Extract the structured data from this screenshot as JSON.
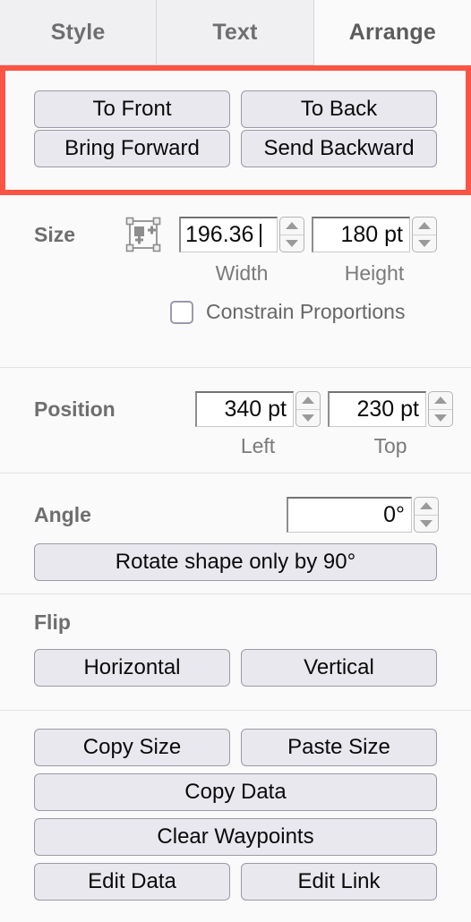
{
  "tabs": [
    {
      "id": "style",
      "label": "Style",
      "active": false
    },
    {
      "id": "text",
      "label": "Text",
      "active": false
    },
    {
      "id": "arrange",
      "label": "Arrange",
      "active": true
    }
  ],
  "order_section": {
    "highlighted": true,
    "highlight_color": "#fb5344",
    "buttons": {
      "to_front": "To Front",
      "to_back": "To Back",
      "bring_forward": "Bring Forward",
      "send_backward": "Send Backward"
    }
  },
  "size_section": {
    "title": "Size",
    "autosize_icon": "autosize-icon",
    "width": {
      "value": "196.36 ",
      "label": "Width",
      "focused": true
    },
    "height": {
      "value": "180 pt",
      "label": "Height",
      "focused": false
    },
    "constrain": {
      "label": "Constrain Proportions",
      "checked": false
    }
  },
  "position_section": {
    "title": "Position",
    "left": {
      "value": "340 pt",
      "label": "Left"
    },
    "top": {
      "value": "230 pt",
      "label": "Top"
    }
  },
  "angle_section": {
    "title": "Angle",
    "angle": {
      "value": "0°"
    },
    "rotate_button": "Rotate shape only by 90°"
  },
  "flip_section": {
    "title": "Flip",
    "horizontal": "Horizontal",
    "vertical": "Vertical"
  },
  "actions_section": {
    "copy_size": "Copy Size",
    "paste_size": "Paste Size",
    "copy_data": "Copy Data",
    "clear_waypoints": "Clear Waypoints",
    "edit_data": "Edit Data",
    "edit_link": "Edit Link"
  }
}
